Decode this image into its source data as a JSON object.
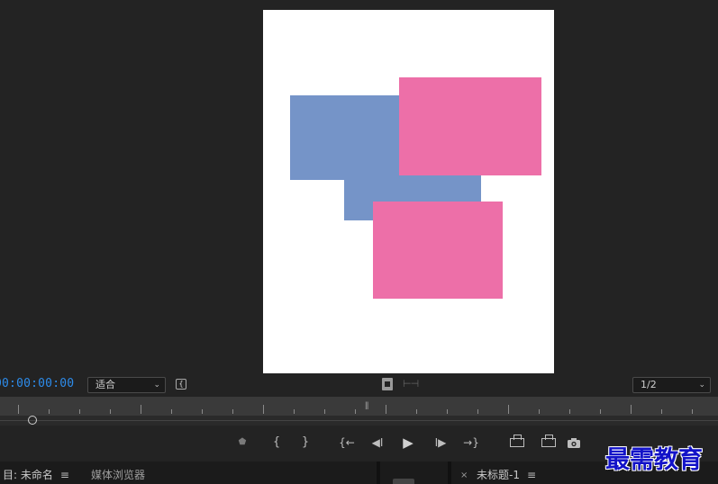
{
  "program_monitor": {
    "timecode": "00:00:00:00",
    "zoom_select": {
      "selected": "适合"
    },
    "resolution_select": {
      "selected": "1/2"
    },
    "canvas": {
      "background": "#ffffff",
      "shapes": [
        {
          "name": "blue-rect-1",
          "color": "#7594c8"
        },
        {
          "name": "blue-rect-2",
          "color": "#7594c8"
        },
        {
          "name": "pink-rect-1",
          "color": "#ed6fa8"
        },
        {
          "name": "pink-rect-2",
          "color": "#ed6fa8"
        }
      ]
    }
  },
  "transport": {
    "marker": "⬟",
    "mark_in": "{",
    "mark_out": "}",
    "go_to_in": "{←",
    "step_back": "◀I",
    "play": "▶",
    "step_forward": "I▶",
    "go_to_out": "→}",
    "camera": "📷"
  },
  "bottom_panels": {
    "project_tab": "目: 未命名",
    "media_browser_tab": "媒体浏览器",
    "sequence_tab": "未标题-1",
    "menu_glyph": "≡",
    "close_glyph": "×"
  },
  "watermark": "最需教育",
  "colors": {
    "timecode": "#2d8ceb",
    "background": "#232323",
    "watermark": "#1212c8"
  }
}
